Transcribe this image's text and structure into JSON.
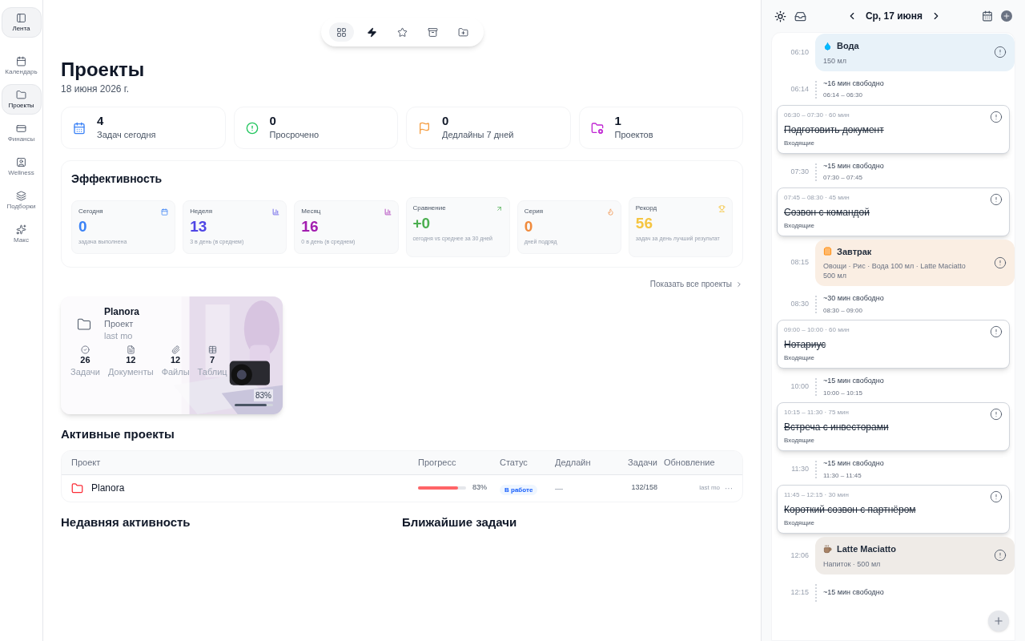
{
  "sidebar": {
    "items": [
      {
        "label": "Лента",
        "selected": true
      },
      {
        "label": "Календарь",
        "selected": false
      },
      {
        "label": "Проекты",
        "selected": true
      },
      {
        "label": "Финансы",
        "selected": false
      },
      {
        "label": "Wellness",
        "selected": false
      },
      {
        "label": "Подборки",
        "selected": false
      },
      {
        "label": "Макс",
        "selected": false
      }
    ]
  },
  "toolbar": [
    {
      "selected": true
    },
    {
      "selected": false
    },
    {
      "selected": false
    },
    {
      "selected": false
    },
    {
      "selected": false
    }
  ],
  "page": {
    "title": "Проекты",
    "date": "18 июня 2026 г."
  },
  "stats": [
    {
      "value": "4",
      "label": "Задач сегодня",
      "color": "#3b82f6"
    },
    {
      "value": "0",
      "label": "Просрочено",
      "color": "#22c55e"
    },
    {
      "value": "0",
      "label": "Дедлайны 7 дней",
      "color": "#f59e42"
    },
    {
      "value": "1",
      "label": "Проектов",
      "color": "#c026d3"
    }
  ],
  "efficiency": {
    "title": "Эффективность",
    "cards": [
      {
        "label": "Сегодня",
        "value": "0",
        "note": "задача выполнена",
        "color": "#3b82f6"
      },
      {
        "label": "Неделя",
        "value": "13",
        "note": "3 в день (в среднем)",
        "color": "#4f46e5"
      },
      {
        "label": "Месяц",
        "value": "16",
        "note": "0 в день (в среднем)",
        "color": "#a21caf"
      },
      {
        "label": "Сравнение",
        "value": "+0",
        "note": "сегодня vs среднее за 30 дней",
        "color": "#4caf50"
      },
      {
        "label": "Серия",
        "value": "0",
        "note": "дней подряд",
        "color": "#f08a3c"
      },
      {
        "label": "Рекорд",
        "value": "56",
        "note": "задач за день лучший результат",
        "color": "#f5c542"
      }
    ]
  },
  "show_all": "Показать все проекты",
  "project_card": {
    "name": "Planora",
    "type": "Проект",
    "updated": "last mo",
    "counts": [
      {
        "value": "26",
        "label": "Задачи"
      },
      {
        "value": "12",
        "label": "Документы"
      },
      {
        "value": "12",
        "label": "Файлы"
      },
      {
        "value": "7",
        "label": "Таблиц"
      }
    ],
    "percent": "83%",
    "level": 0.83
  },
  "active_projects": {
    "title": "Активные проекты",
    "columns": [
      "Проект",
      "Прогресс",
      "Статус",
      "Дедлайн",
      "Задачи",
      "Обновление"
    ],
    "rows": [
      {
        "name": "Planora",
        "level": 0.83,
        "percent": "83%",
        "status": "В работе",
        "deadline": "—",
        "tasks": "132/158",
        "updated": "last mo",
        "more": "···"
      }
    ]
  },
  "recent_activity": {
    "title": "Недавняя активность"
  },
  "upcoming": {
    "title": "Ближайшие задачи"
  },
  "day_panel": {
    "date": "Ср, 17 июня",
    "items": [
      {
        "kind": "water",
        "time": "06:10",
        "title": "Вода",
        "detail": "150 мл",
        "color": "#e8f2f9"
      },
      {
        "kind": "free",
        "time": "06:14",
        "title": "~16 мин свободно",
        "range": "06:14 – 06:30"
      },
      {
        "kind": "task",
        "range": "06:30 – 07:30 · 60 мин",
        "title": "Подготовить документ",
        "list": "Входящие",
        "done": true
      },
      {
        "kind": "free",
        "time": "07:30",
        "title": "~15 мин свободно",
        "range": "07:30 – 07:45"
      },
      {
        "kind": "task",
        "range": "07:45 – 08:30 · 45 мин",
        "title": "Созвон с командой",
        "list": "Входящие",
        "done": true
      },
      {
        "kind": "meal",
        "time": "08:15",
        "title": "Завтрак",
        "detail": "Овощи · Рис · Вода 100 мл · Latte Maciatto 500 мл",
        "color": "#faeee3"
      },
      {
        "kind": "free",
        "time": "08:30",
        "title": "~30 мин свободно",
        "range": "08:30 – 09:00"
      },
      {
        "kind": "task",
        "range": "09:00 – 10:00 · 60 мин",
        "title": "Нотариус",
        "list": "Входящие",
        "done": true
      },
      {
        "kind": "free",
        "time": "10:00",
        "title": "~15 мин свободно",
        "range": "10:00 – 10:15"
      },
      {
        "kind": "task",
        "range": "10:15 – 11:30 · 75 мин",
        "title": "Встреча с инвесторами",
        "list": "Входящие",
        "done": true
      },
      {
        "kind": "free",
        "time": "11:30",
        "title": "~15 мин свободно",
        "range": "11:30 – 11:45"
      },
      {
        "kind": "task",
        "range": "11:45 – 12:15 · 30 мин",
        "title": "Короткий созвон с партнёром",
        "list": "Входящие",
        "done": true
      },
      {
        "kind": "drink",
        "time": "12:06",
        "title": "Latte Maciatto",
        "detail": "Напиток · 500 мл",
        "color": "#efebe7"
      },
      {
        "kind": "free",
        "time": "12:15",
        "title": "~15 мин свободно"
      }
    ]
  }
}
